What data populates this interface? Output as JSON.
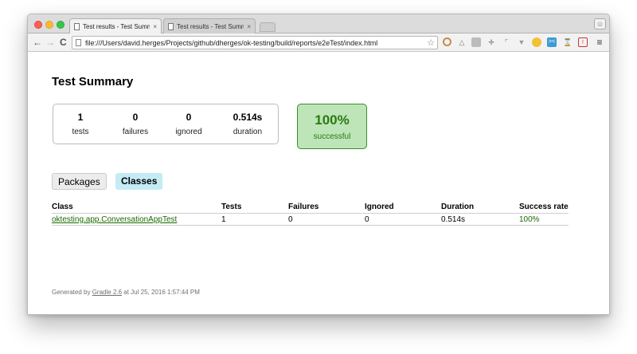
{
  "browser": {
    "tabs": [
      {
        "title": "Test results - Test Summary",
        "active": true
      },
      {
        "title": "Test results - Test Summary",
        "active": false
      }
    ],
    "url": "file:///Users/david.herges/Projects/github/dherges/ok-testing/build/reports/e2eTest/index.html",
    "nav": {
      "back": "←",
      "forward": "→",
      "reload": "C"
    },
    "close_glyph": "×",
    "star_glyph": "☆",
    "menu_glyph": "≡",
    "extensions": [
      "circle-icon",
      "triangle-icon",
      "puzzle-icon",
      "move-icon",
      "ruler-icon",
      "filter-icon",
      "emoji-icon",
      "devtools-icon",
      "goblet-icon",
      "badge-icon"
    ]
  },
  "page": {
    "title": "Test Summary",
    "counters": [
      {
        "value": "1",
        "label": "tests"
      },
      {
        "value": "0",
        "label": "failures"
      },
      {
        "value": "0",
        "label": "ignored"
      },
      {
        "value": "0.514s",
        "label": "duration"
      }
    ],
    "success": {
      "value": "100%",
      "label": "successful"
    },
    "tabs": {
      "packages": "Packages",
      "classes": "Classes"
    },
    "table": {
      "headers": [
        "Class",
        "Tests",
        "Failures",
        "Ignored",
        "Duration",
        "Success rate"
      ],
      "rows": [
        [
          "oktesting.app.ConversationAppTest",
          "1",
          "0",
          "0",
          "0.514s",
          "100%"
        ]
      ]
    },
    "footer": {
      "prefix": "Generated by ",
      "link": "Gradle 2.6",
      "suffix": " at Jul 25, 2016 1:57:44 PM"
    }
  },
  "colors": {
    "success_bg": "#bde5b8",
    "success_text": "#2a7a0f",
    "active_tab_bg": "#c5ebf5"
  }
}
